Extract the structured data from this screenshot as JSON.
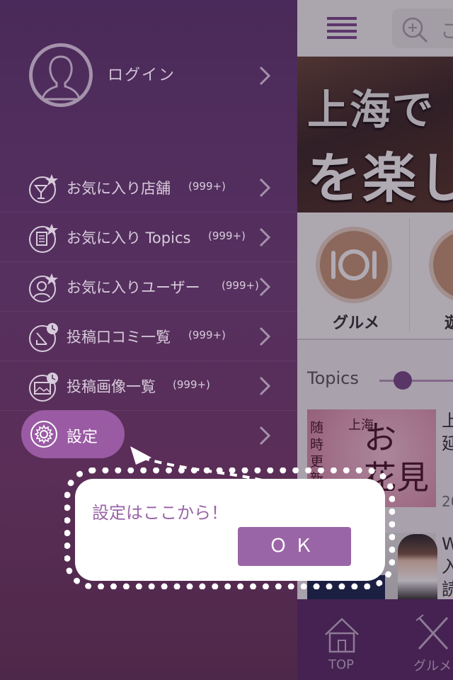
{
  "app": {
    "search_hint": "こ",
    "banner_line1": "上海で",
    "banner_line2": "を楽し",
    "categories": [
      {
        "label": "グルメ"
      },
      {
        "label": "遊"
      }
    ],
    "topics_title": "Topics",
    "topic_items": [
      {
        "title_lines": [
          "上",
          "延"
        ],
        "date": "20",
        "thumb_vertical": "随時更新中",
        "thumb_big1": "お",
        "thumb_big2": "花見",
        "thumb_small": "上海"
      },
      {
        "title_lines": [
          "W",
          "入",
          "読"
        ]
      }
    ],
    "tabs": [
      {
        "label": "TOP"
      },
      {
        "label": "グルメ"
      }
    ]
  },
  "drawer": {
    "login_label": "ログイン",
    "menu": [
      {
        "label": "お気に入り店舗",
        "count": "(999+)",
        "icon": "favorite-shop-icon"
      },
      {
        "label": "お気に入り Topics",
        "count": "(999+)",
        "icon": "favorite-topics-icon"
      },
      {
        "label": "お気に入りユーザー",
        "count": "(999+)",
        "icon": "favorite-user-icon"
      },
      {
        "label": "投稿口コミ一覧",
        "count": "(999+)",
        "icon": "review-list-icon"
      },
      {
        "label": "投稿画像一覧",
        "count": "(999+)",
        "icon": "image-list-icon"
      }
    ],
    "settings_label": "設定"
  },
  "tooltip": {
    "text": "設定はここから！",
    "ok_label": "ＯＫ"
  },
  "colors": {
    "drawer_bg": "#4e2c5a",
    "accent": "#9a65a6",
    "settings_pill": "#9a5aa4",
    "tabbar": "#5b2f6b"
  }
}
